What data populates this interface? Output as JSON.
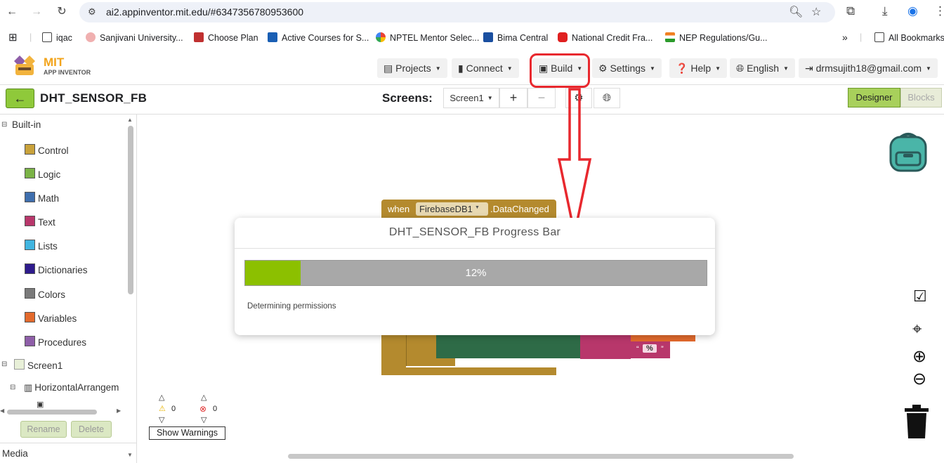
{
  "browser": {
    "url": "ai2.appinventor.mit.edu/#6347356780953600"
  },
  "bookmarks": [
    {
      "label": "iqac",
      "color": "#444"
    },
    {
      "label": "Sanjivani University...",
      "color": "#e08080"
    },
    {
      "label": "Choose Plan",
      "color": "#c03030"
    },
    {
      "label": "Active Courses for S...",
      "color": "#1a5fb4"
    },
    {
      "label": "NPTEL Mentor Selec...",
      "color": "#4285f4"
    },
    {
      "label": "Bima Central",
      "color": "#1a4fa0"
    },
    {
      "label": "National Credit Fra...",
      "color": "#e02020"
    },
    {
      "label": "NEP Regulations/Gu...",
      "color": "#f08020"
    },
    {
      "label": "All Bookmarks",
      "color": "#444"
    }
  ],
  "app": {
    "logo_mit": "MIT",
    "logo_sub": "APP INVENTOR",
    "menu": {
      "projects": "Projects",
      "connect": "Connect",
      "build": "Build",
      "settings": "Settings",
      "help": "Help",
      "language": "English",
      "account": "drmsujith18@gmail.com"
    }
  },
  "project": {
    "name": "DHT_SENSOR_FB",
    "screens_label": "Screens:",
    "screen_selected": "Screen1",
    "add": "+",
    "remove": "−",
    "designer": "Designer",
    "blocks": "Blocks"
  },
  "palette": {
    "builtin": "Built-in",
    "items": [
      {
        "label": "Control",
        "color": "#c9a23b"
      },
      {
        "label": "Logic",
        "color": "#7bb347"
      },
      {
        "label": "Math",
        "color": "#3f6fae"
      },
      {
        "label": "Text",
        "color": "#b8376b"
      },
      {
        "label": "Lists",
        "color": "#42b5e0"
      },
      {
        "label": "Dictionaries",
        "color": "#2e1b8c"
      },
      {
        "label": "Colors",
        "color": "#7a7a7a"
      },
      {
        "label": "Variables",
        "color": "#e36a2d"
      },
      {
        "label": "Procedures",
        "color": "#8e5ea8"
      }
    ],
    "screen": "Screen1",
    "arrangement": "HorizontalArrangem",
    "rename": "Rename",
    "delete": "Delete",
    "media": "Media"
  },
  "blocks": {
    "event_when": "when",
    "event_component": "FirebaseDB1",
    "event_name": ".DataChanged",
    "text_percent": "%"
  },
  "dialog": {
    "title": "DHT_SENSOR_FB Progress Bar",
    "progress": 0.12,
    "progress_text": "12%",
    "status": "Determining permissions"
  },
  "warnings": {
    "warn_count": "0",
    "error_count": "0",
    "show_warnings": "Show Warnings"
  },
  "colors": {
    "accent_green": "#8fc93a",
    "progress_fill": "#8cc000",
    "annotation_red": "#e8282e"
  }
}
